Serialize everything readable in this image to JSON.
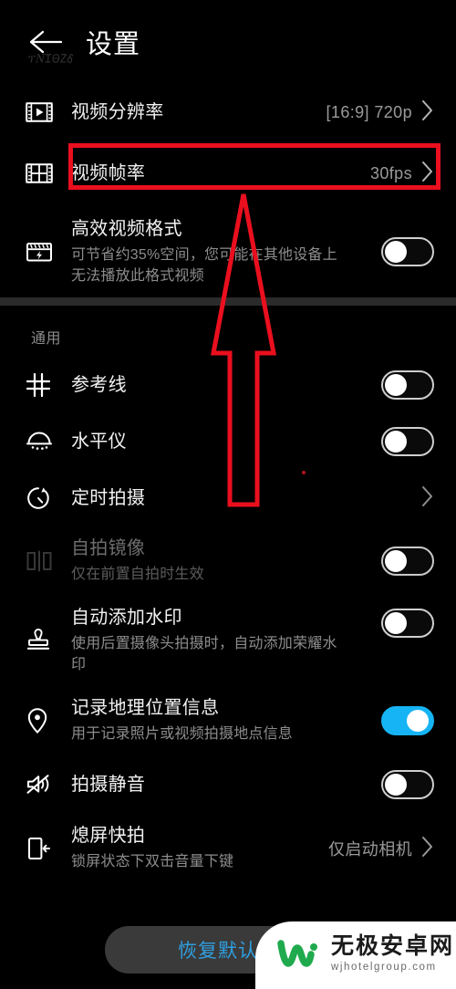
{
  "header": {
    "title": "设置",
    "back_icon": "back-arrow-icon",
    "ghost_mark": "ፕ𝑁ᏆᎾᏃᎴ"
  },
  "video_section": {
    "rows": [
      {
        "icon": "video-resolution-icon",
        "title": "视频分辨率",
        "value": "[16:9] 720p",
        "chevron": "chevron-right-icon"
      },
      {
        "icon": "video-framerate-icon",
        "title": "视频帧率",
        "value": "30fps",
        "chevron": "chevron-right-icon"
      },
      {
        "icon": "efficient-video-icon",
        "title": "高效视频格式",
        "subtitle": "可节省约35%空间，您可能在其他设备上无法播放此格式视频",
        "toggle": "off"
      }
    ]
  },
  "general_section": {
    "label": "通用",
    "rows": [
      {
        "icon": "grid-lines-icon",
        "title": "参考线",
        "toggle": "off"
      },
      {
        "icon": "level-meter-icon",
        "title": "水平仪",
        "toggle": "off"
      },
      {
        "icon": "timer-icon",
        "title": "定时拍摄",
        "chevron": "chevron-right-icon"
      },
      {
        "icon": "mirror-icon",
        "title": "自拍镜像",
        "subtitle": "仅在前置自拍时生效",
        "toggle": "off",
        "disabled": true
      },
      {
        "icon": "watermark-stamp-icon",
        "title": "自动添加水印",
        "subtitle": "使用后置摄像头拍摄时，自动添加荣耀水印",
        "toggle": "off"
      },
      {
        "icon": "location-pin-icon",
        "title": "记录地理位置信息",
        "subtitle": "用于记录照片或视频拍摄地点信息",
        "toggle": "on"
      },
      {
        "icon": "mute-icon",
        "title": "拍摄静音",
        "toggle": "off"
      },
      {
        "icon": "screen-off-capture-icon",
        "title": "熄屏快拍",
        "subtitle": "锁屏状态下双击音量下键",
        "value": "仅启动相机",
        "chevron": "chevron-right-icon"
      }
    ]
  },
  "footer": {
    "reset_label": "恢复默认值"
  },
  "annotations": {
    "highlight_color": "#ea0f1e",
    "arrow_color": "#ea0f1e",
    "highlight_target": "视频帧率"
  },
  "watermark": {
    "logo": "w-logo-icon",
    "site_name": "无极安卓网",
    "site_url": "wjhotelgroup.com"
  },
  "colors": {
    "background": "#000000",
    "accent_on": "#16b4f5",
    "link": "#2f9fe0",
    "divider": "#2b2b2b"
  }
}
